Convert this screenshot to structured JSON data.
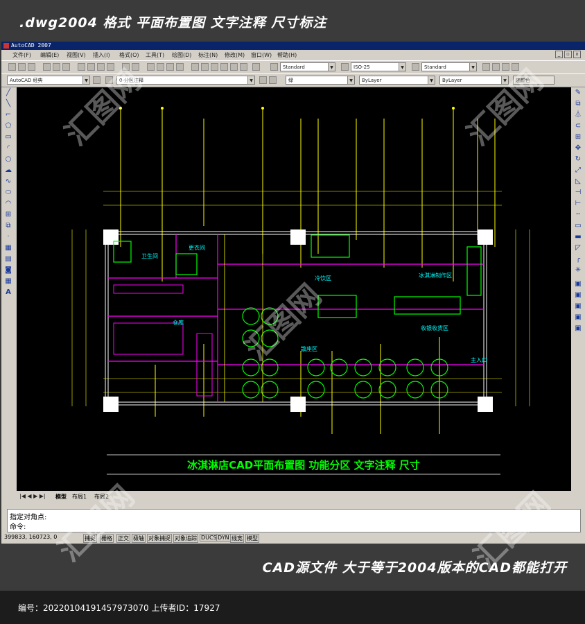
{
  "banner": {
    "title": ".dwg2004 格式  平面布置图 文字注释 尺寸标注"
  },
  "window": {
    "title": "AutoCAD 2007"
  },
  "menu": [
    "文件(F)",
    "编辑(E)",
    "视图(V)",
    "插入(I)",
    "格式(O)",
    "工具(T)",
    "绘图(D)",
    "标注(N)",
    "修改(M)",
    "窗口(W)",
    "帮助(H)"
  ],
  "toolbar": {
    "text_style": "Standard",
    "dim_style": "ISO-25",
    "table_style": "Standard",
    "workspace": "AutoCAD 经典",
    "layer": "0-分区注释",
    "color": "绿",
    "linetype": "ByLayer",
    "lineweight": "ByLayer",
    "plotstyle": "随颜色"
  },
  "drawing": {
    "title": "冰淇淋店CAD平面布置图   功能分区   文字注释   尺寸",
    "rooms": [
      "卫生间",
      "更衣间",
      "仓库",
      "冷饮区",
      "冰淇淋制作区",
      "收银收货区",
      "散座区",
      "主入口"
    ]
  },
  "tabs": [
    "模型",
    "布局1",
    "布局2"
  ],
  "command": {
    "line1": "指定对角点:",
    "line2": "命令:"
  },
  "status": {
    "coords": "399833, 160723, 0",
    "buttons": [
      "捕捉",
      "栅格",
      "正交",
      "极轴",
      "对象捕捉",
      "对象追踪",
      "DUCS",
      "DYN",
      "线宽",
      "模型"
    ]
  },
  "banner2": {
    "text": "CAD源文件  大于等于2004版本的CAD都能打开"
  },
  "footer": {
    "text": "编号：20220104191457973070 上传者ID：17927"
  },
  "watermark": "汇图网",
  "colors": {
    "canvas": "#000000",
    "green": "#00ff00",
    "yellow": "#ffff00",
    "magenta": "#ff00ff",
    "cyan": "#00ffff"
  }
}
